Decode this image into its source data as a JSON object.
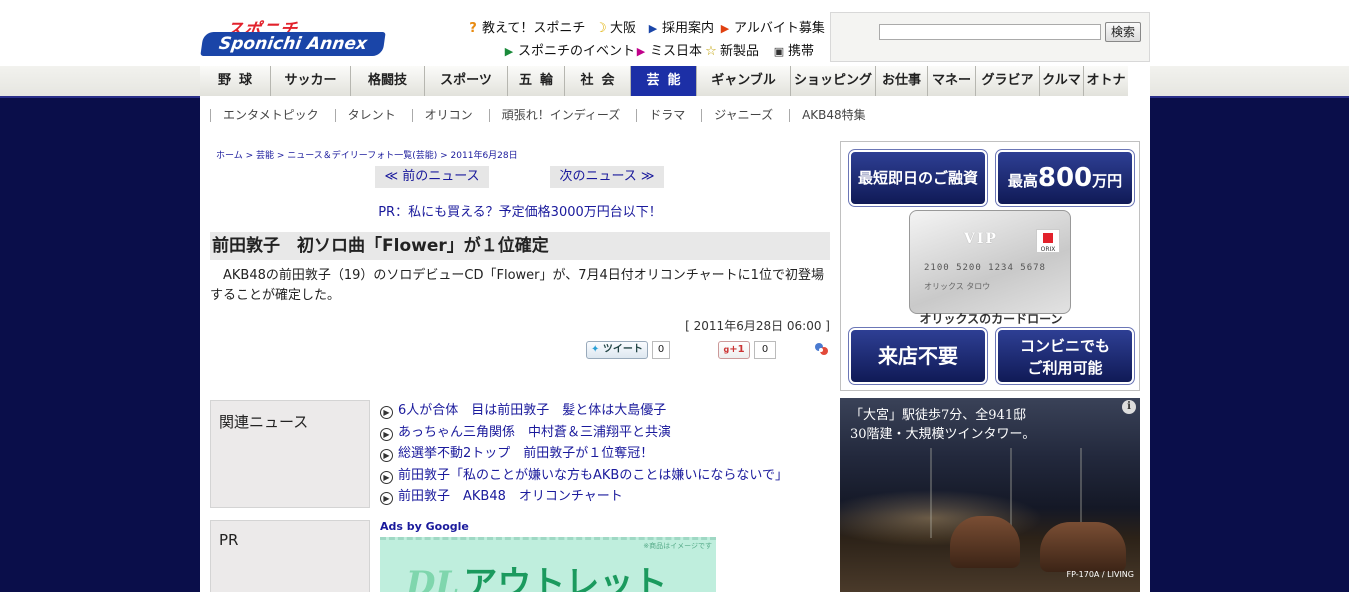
{
  "header": {
    "logo_top": "スポニチ",
    "logo_main": "Sponichi Annex",
    "links": [
      {
        "label": "教えて！スポニチ",
        "icon": "question-icon",
        "color": "#e88a10"
      },
      {
        "label": "大阪",
        "icon": "moon-icon",
        "color": "#e0b000"
      },
      {
        "label": "採用案内",
        "icon": "arrow-icon",
        "color": "#1a45a8"
      },
      {
        "label": "アルバイト募集",
        "icon": "arrow-icon",
        "color": "#e04010"
      },
      {
        "label": "スポニチのイベント",
        "icon": "arrow-icon",
        "color": "#1a8a3a"
      },
      {
        "label": "ミス日本",
        "icon": "arrow-icon",
        "color": "#c0008a"
      },
      {
        "label": "新製品",
        "icon": "star-icon",
        "color": "#c0a000"
      },
      {
        "label": "携帯",
        "icon": "phone-icon",
        "color": "#333333"
      }
    ],
    "search": {
      "placeholder": "",
      "button": "検索"
    }
  },
  "nav": [
    {
      "label": "野球",
      "active": false
    },
    {
      "label": "サッカー",
      "active": false
    },
    {
      "label": "格闘技",
      "active": false
    },
    {
      "label": "スポーツ",
      "active": false
    },
    {
      "label": "五輪",
      "active": false
    },
    {
      "label": "社会",
      "active": false
    },
    {
      "label": "芸能",
      "active": true
    },
    {
      "label": "ギャンブル",
      "active": false
    },
    {
      "label": "ショッピング",
      "active": false
    },
    {
      "label": "お仕事",
      "active": false
    },
    {
      "label": "マネー",
      "active": false
    },
    {
      "label": "グラビア",
      "active": false
    },
    {
      "label": "クルマ",
      "active": false
    },
    {
      "label": "オトナ",
      "active": false
    }
  ],
  "subnav": [
    "エンタメトピック",
    "タレント",
    "オリコン",
    "頑張れ！インディーズ",
    "ドラマ",
    "ジャニーズ",
    "AKB48特集"
  ],
  "article": {
    "breadcrumb": "ホーム > 芸能 > ニュース＆デイリーフォト一覧(芸能) > 2011年6月28日",
    "prev": "≪ 前のニュース",
    "next": "次のニュース ≫",
    "pr_line": "PR：私にも買える？予定価格3000万円台以下！",
    "headline": "前田敦子　初ソロ曲「Flower」が１位確定",
    "body": "AKB48の前田敦子（19）のソロデビューCD「Flower」が、7月4日付オリコンチャートに1位で初登場することが確定した。",
    "date": "[ 2011年6月28日 06:00 ]",
    "tweet_label": "ツイート",
    "tweet_count": "0",
    "gplus_label": "+1",
    "gplus_count": "0"
  },
  "related": {
    "heading": "関連ニュース",
    "items": [
      "6人が合体　目は前田敦子　髪と体は大島優子",
      "あっちゃん三角関係　中村蒼＆三浦翔平と共演",
      "総選挙不動2トップ　前田敦子が１位奪冠！",
      "前田敦子「私のことが嫌いな方もAKBのことは嫌いにならないで」",
      "前田敦子　AKB48　オリコンチャート"
    ]
  },
  "pr": {
    "heading": "PR",
    "ads_label": "Ads by Google",
    "banner_note": "※商品はイメージです",
    "banner_dl": "DL",
    "banner_text": "アウトレット"
  },
  "ad_orix": {
    "tile1": "最短即日のご融資",
    "tile2_prefix": "最高",
    "tile2_big": "800",
    "tile2_suffix": "万円",
    "card_vip": "VIP",
    "card_number": "2100 5200 1234 5678",
    "card_name": "オリックス タロウ",
    "card_logo": "ORIX",
    "caption": "オリックスのカードローン",
    "tile3": "来店不要",
    "tile4_line1": "コンビニでも",
    "tile4_line2": "ご利用可能"
  },
  "ad_mansion": {
    "line1": "「大宮」駅徒歩7分、全941邸",
    "line2": "30階建・大規模ツインタワー。",
    "caption": "FP-170A / LIVING",
    "info": "i"
  }
}
